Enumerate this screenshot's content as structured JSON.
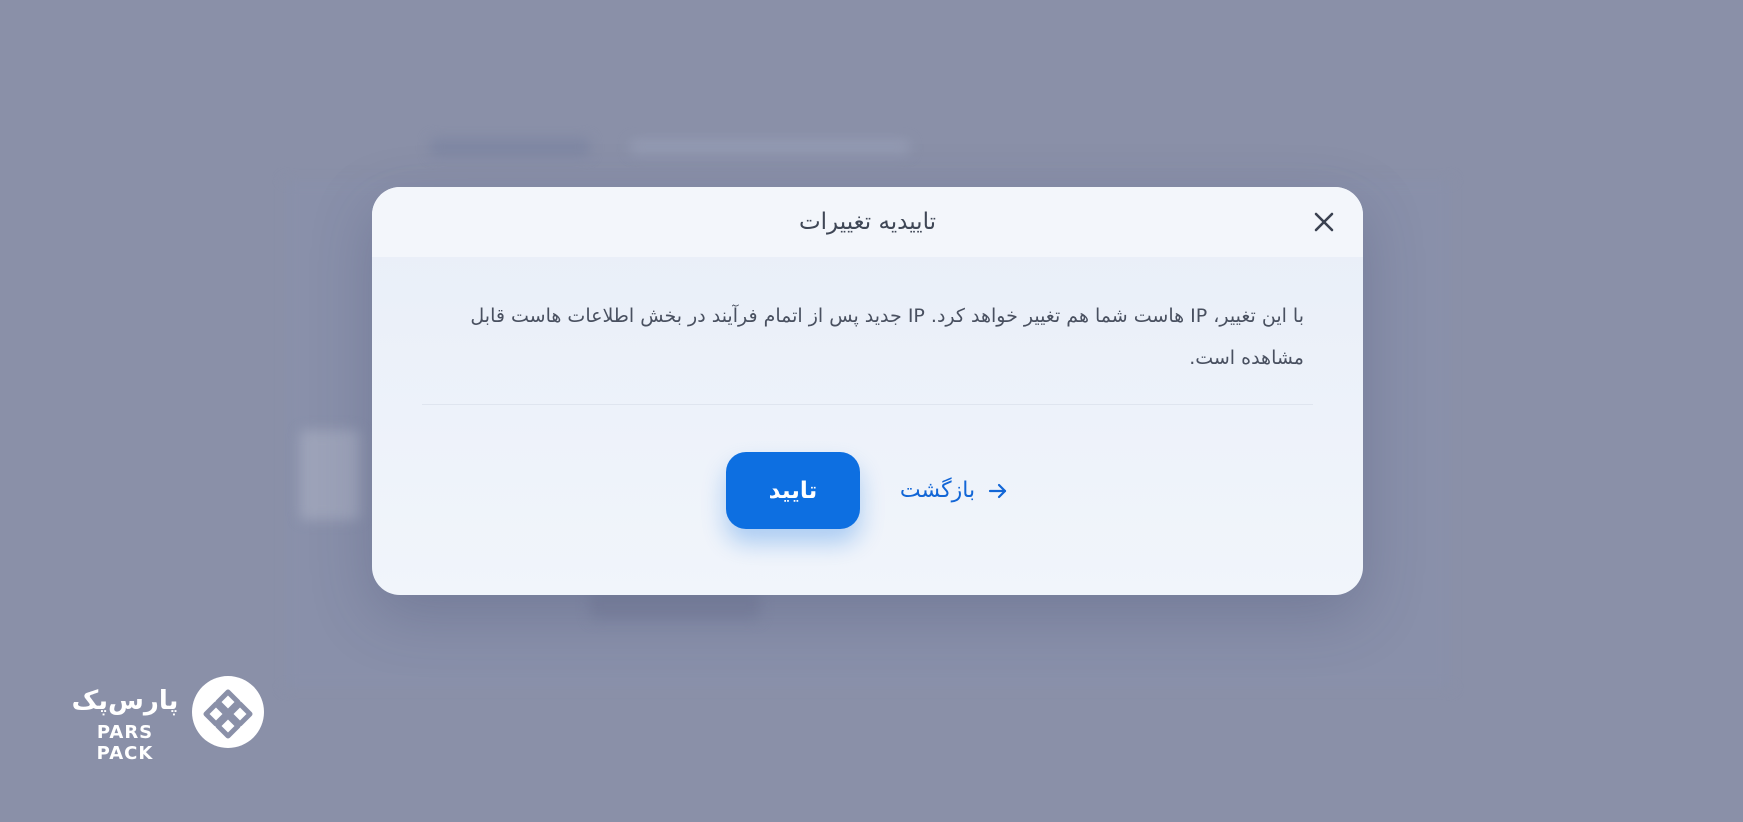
{
  "dialog": {
    "title": "تاییدیه تغییرات",
    "message": "با این تغییر، IP هاست شما هم تغییر خواهد کرد. IP جدید پس از اتمام فرآیند در بخش اطلاعات هاست قابل مشاهده است.",
    "confirm_label": "تایید",
    "back_label": "بازگشت"
  },
  "logo": {
    "text_fa": "پارس‌پک",
    "text_en": "PARS PACK"
  },
  "colors": {
    "background": "#8a90a8",
    "accent": "#0d6fe1",
    "link": "#1266d6"
  },
  "icons": {
    "close": "close-icon",
    "back": "arrow-right-icon",
    "logo": "parspack-logo-icon"
  }
}
